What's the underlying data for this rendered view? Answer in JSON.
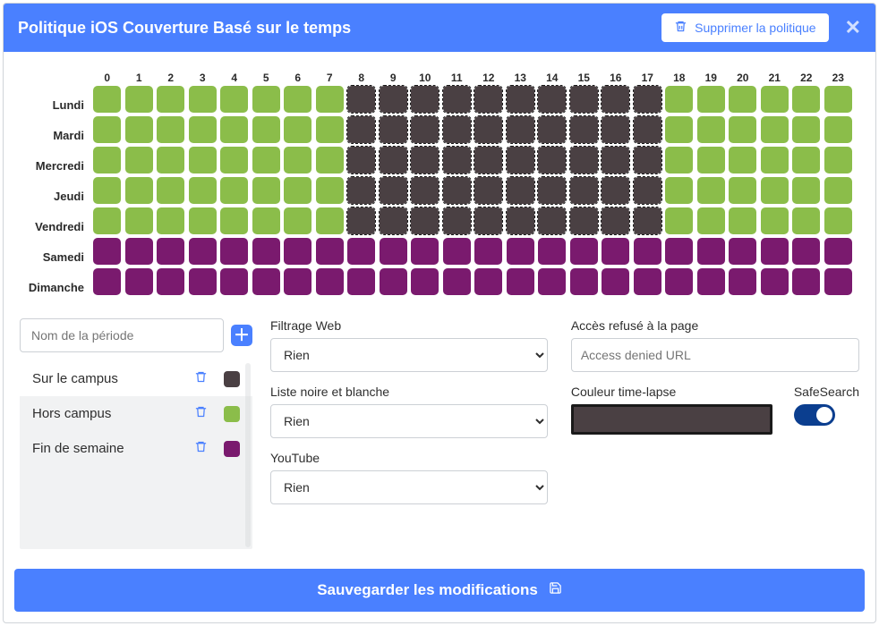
{
  "header": {
    "title": "Politique iOS Couverture Basé sur le temps",
    "deletePolicy": "Supprimer la politique"
  },
  "schedule": {
    "hours": [
      "0",
      "1",
      "2",
      "3",
      "4",
      "5",
      "6",
      "7",
      "8",
      "9",
      "10",
      "11",
      "12",
      "13",
      "14",
      "15",
      "16",
      "17",
      "18",
      "19",
      "20",
      "21",
      "22",
      "23"
    ],
    "days": [
      "Lundi",
      "Mardi",
      "Mercredi",
      "Jeudi",
      "Vendredi",
      "Samedi",
      "Dimanche"
    ],
    "grid": [
      [
        "g",
        "g",
        "g",
        "g",
        "g",
        "g",
        "g",
        "g",
        "d",
        "d",
        "d",
        "d",
        "d",
        "d",
        "d",
        "d",
        "d",
        "d",
        "g",
        "g",
        "g",
        "g",
        "g",
        "g"
      ],
      [
        "g",
        "g",
        "g",
        "g",
        "g",
        "g",
        "g",
        "g",
        "d",
        "d",
        "d",
        "d",
        "d",
        "d",
        "d",
        "d",
        "d",
        "d",
        "g",
        "g",
        "g",
        "g",
        "g",
        "g"
      ],
      [
        "g",
        "g",
        "g",
        "g",
        "g",
        "g",
        "g",
        "g",
        "d",
        "d",
        "d",
        "d",
        "d",
        "d",
        "d",
        "d",
        "d",
        "d",
        "g",
        "g",
        "g",
        "g",
        "g",
        "g"
      ],
      [
        "g",
        "g",
        "g",
        "g",
        "g",
        "g",
        "g",
        "g",
        "d",
        "d",
        "d",
        "d",
        "d",
        "d",
        "d",
        "d",
        "d",
        "d",
        "g",
        "g",
        "g",
        "g",
        "g",
        "g"
      ],
      [
        "g",
        "g",
        "g",
        "g",
        "g",
        "g",
        "g",
        "g",
        "d",
        "d",
        "d",
        "d",
        "d",
        "d",
        "d",
        "d",
        "d",
        "d",
        "g",
        "g",
        "g",
        "g",
        "g",
        "g"
      ],
      [
        "p",
        "p",
        "p",
        "p",
        "p",
        "p",
        "p",
        "p",
        "p",
        "p",
        "p",
        "p",
        "p",
        "p",
        "p",
        "p",
        "p",
        "p",
        "p",
        "p",
        "p",
        "p",
        "p",
        "p"
      ],
      [
        "p",
        "p",
        "p",
        "p",
        "p",
        "p",
        "p",
        "p",
        "p",
        "p",
        "p",
        "p",
        "p",
        "p",
        "p",
        "p",
        "p",
        "p",
        "p",
        "p",
        "p",
        "p",
        "p",
        "p"
      ]
    ]
  },
  "periods": {
    "inputPlaceholder": "Nom de la période",
    "items": [
      {
        "name": "Sur le campus",
        "color": "#4a4043",
        "active": true
      },
      {
        "name": "Hors campus",
        "color": "#8bbd4a",
        "active": false
      },
      {
        "name": "Fin de semaine",
        "color": "#7a1a6e",
        "active": false
      }
    ]
  },
  "filters": {
    "webFilteringLabel": "Filtrage Web",
    "webFilteringValue": "Rien",
    "blackWhiteLabel": "Liste noire et blanche",
    "blackWhiteValue": "Rien",
    "youtubeLabel": "YouTube",
    "youtubeValue": "Rien"
  },
  "access": {
    "deniedLabel": "Accès refusé à la page",
    "deniedPlaceholder": "Access denied URL",
    "timelapseColorLabel": "Couleur time-lapse",
    "safeSearchLabel": "SafeSearch"
  },
  "footer": {
    "saveLabel": "Sauvegarder les modifications"
  }
}
